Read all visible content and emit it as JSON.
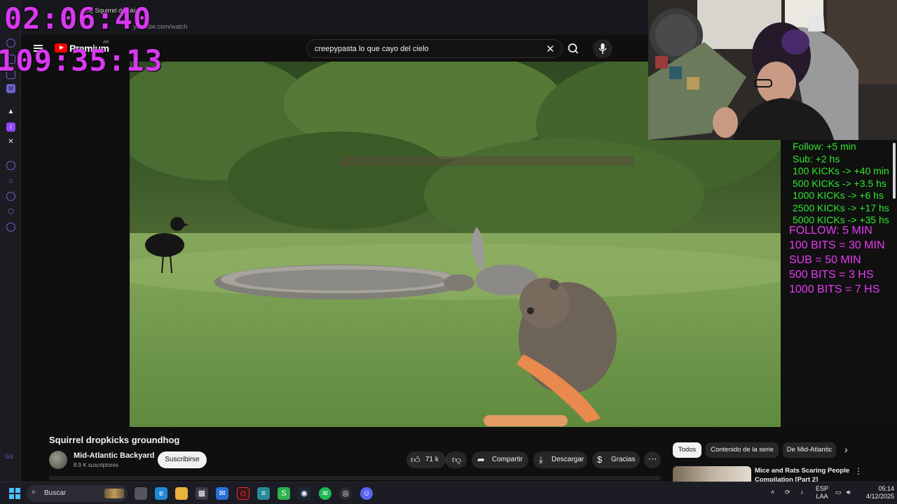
{
  "browser": {
    "tab_title": "(14) Squirrel dropki...",
    "url": "youtube.com/watch"
  },
  "overlay": {
    "timer_top": "02:06:40",
    "timer_bottom": "109:35:13"
  },
  "youtube": {
    "brand": "Premium",
    "country": "AR",
    "search_query": "creepypasta lo que cayo del cielo"
  },
  "video": {
    "title": "Squirrel dropkicks groundhog",
    "channel": "Mid-Atlantic Backyard",
    "subscribers": "8.9 K suscriptores",
    "subscribe_label": "Suscribirse",
    "likes": "71 k",
    "share_label": "Compartir",
    "download_label": "Descargar",
    "thanks_label": "Gracias"
  },
  "chips": [
    "Todos",
    "Contenido de la serie",
    "De Mid-Atlantic"
  ],
  "recommendation": {
    "title": "Mice and Rats Scaring People Compilation [Part 2]"
  },
  "stream_rules": {
    "kicks": [
      "Follow: +5 min",
      "Sub: +2 hs",
      "100 KICKs -> +40 min",
      "500 KICKs -> +3.5 hs",
      "1000 KICKs -> +6 hs",
      "2500 KICKs -> +17 hs",
      "5000 KICKs -> +35 hs"
    ],
    "twitch": [
      "FOLLOW: 5 MIN",
      "100 BITS = 30 MIN",
      "SUB = 50 MIN",
      "500 BITS = 3 HS",
      "1000 BITS = 7 HS"
    ]
  },
  "taskbar": {
    "search_placeholder": "Buscar",
    "language": "ESP",
    "layout": "LAA",
    "time": "05:14",
    "date": "4/12/2025"
  }
}
